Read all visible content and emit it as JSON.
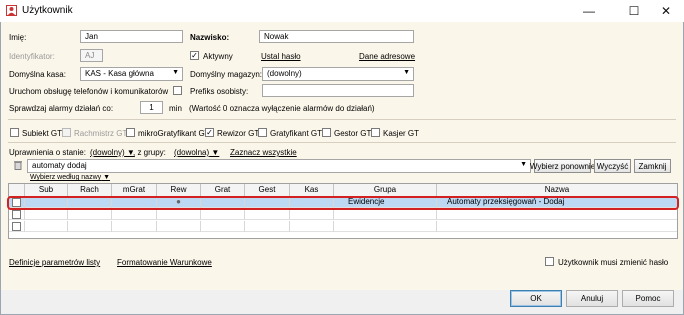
{
  "window": {
    "title": "Użytkownik",
    "controls": {
      "minimize": "—",
      "maximize": "☐",
      "close": "✕"
    }
  },
  "form": {
    "imie_label": "Imię:",
    "imie_value": "Jan",
    "nazwisko_label": "Nazwisko:",
    "nazwisko_value": "Nowak",
    "identyfikator_label": "Identyfikator:",
    "identyfikator_value": "AJ",
    "aktywny_label": "Aktywny",
    "aktywny_checked": "✓",
    "ustal_haslo": "Ustal hasło",
    "dane_adresowe": "Dane adresowe",
    "kasa_label": "Domyślna kasa:",
    "kasa_value": "KAS - Kasa główna",
    "magazyn_label": "Domyślny magazyn:",
    "magazyn_value": "(dowolny)",
    "telefony_label": "Uruchom obsługę telefonów i komunikatorów",
    "prefiks_label": "Prefiks osobisty:",
    "prefiks_value": "",
    "alarmy_label": "Sprawdzaj alarmy działań co:",
    "alarmy_value": "1",
    "alarmy_unit": "min",
    "alarmy_note": "(Wartość 0 oznacza wyłączenie alarmów do działań)"
  },
  "modules": [
    {
      "label": "Subiekt GT",
      "checked": "",
      "disabled": false
    },
    {
      "label": "Rachmistrz GT",
      "checked": "",
      "disabled": true
    },
    {
      "label": "mikroGratyfikant GT",
      "checked": "",
      "disabled": false
    },
    {
      "label": "Rewizor GT",
      "checked": "✓",
      "disabled": false
    },
    {
      "label": "Gratyfikant GT",
      "checked": "",
      "disabled": false
    },
    {
      "label": "Gestor GT",
      "checked": "",
      "disabled": false
    },
    {
      "label": "Kasjer GT",
      "checked": "",
      "disabled": false
    }
  ],
  "permissions": {
    "stan_label": "Uprawnienia o stanie:",
    "stan_value": "(dowolny)",
    "grupa_label": ", z grupy:",
    "grupa_value": "(dowolna)",
    "zaznacz": "Zaznacz wszystkie",
    "search_value": "automaty dodaj",
    "wybierz_wg_nazwy": "Wybierz według nazwy",
    "btn_wybierz": "Wybierz ponownie",
    "btn_wyczysc": "Wyczyść",
    "btn_zamknij": "Zamknij"
  },
  "grid": {
    "columns": [
      "Sub",
      "Rach",
      "mGrat",
      "Rew",
      "Grat",
      "Gest",
      "Kas",
      "Grupa",
      "Nazwa"
    ],
    "rows": [
      {
        "grupa": "Ewidencje",
        "nazwa": "Automaty przeksięgowań - Dodaj",
        "rew_mark": "●"
      },
      {
        "grupa": "",
        "nazwa": "",
        "rew_mark": ""
      },
      {
        "grupa": "",
        "nazwa": "",
        "rew_mark": ""
      }
    ]
  },
  "footer": {
    "definicje": "Definicje parametrów listy",
    "formatowanie": "Formatowanie Warunkowe",
    "musi_zmienic": "Użytkownik musi zmienić hasło",
    "ok": "OK",
    "anuluj": "Anuluj",
    "pomoc": "Pomoc"
  },
  "colors": {
    "form_bg": "#fbf6ea",
    "selection": "#bcd8f3",
    "highlight": "#d32020"
  }
}
